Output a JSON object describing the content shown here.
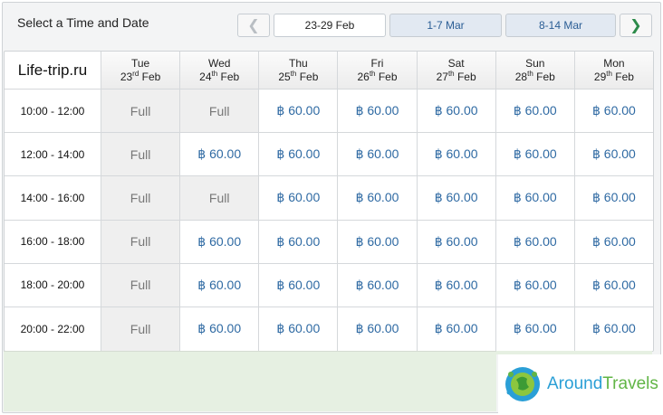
{
  "header": {
    "title": "Select a Time and Date",
    "prev_label": "❮",
    "next_label": "❯",
    "weeks": [
      "23-29 Feb",
      "1-7 Mar",
      "8-14 Mar"
    ]
  },
  "table": {
    "brand": "Life-trip.ru",
    "days": [
      {
        "name": "Tue",
        "num": "23",
        "sup": "rd",
        "month": "Feb"
      },
      {
        "name": "Wed",
        "num": "24",
        "sup": "th",
        "month": "Feb"
      },
      {
        "name": "Thu",
        "num": "25",
        "sup": "th",
        "month": "Feb"
      },
      {
        "name": "Fri",
        "num": "26",
        "sup": "th",
        "month": "Feb"
      },
      {
        "name": "Sat",
        "num": "27",
        "sup": "th",
        "month": "Feb"
      },
      {
        "name": "Sun",
        "num": "28",
        "sup": "th",
        "month": "Feb"
      },
      {
        "name": "Mon",
        "num": "29",
        "sup": "th",
        "month": "Feb"
      }
    ],
    "rows": [
      {
        "time": "10:00 - 12:00",
        "slots": [
          "Full",
          "Full",
          "฿ 60.00",
          "฿ 60.00",
          "฿ 60.00",
          "฿ 60.00",
          "฿ 60.00"
        ]
      },
      {
        "time": "12:00 - 14:00",
        "slots": [
          "Full",
          "฿ 60.00",
          "฿ 60.00",
          "฿ 60.00",
          "฿ 60.00",
          "฿ 60.00",
          "฿ 60.00"
        ]
      },
      {
        "time": "14:00 - 16:00",
        "slots": [
          "Full",
          "Full",
          "฿ 60.00",
          "฿ 60.00",
          "฿ 60.00",
          "฿ 60.00",
          "฿ 60.00"
        ]
      },
      {
        "time": "16:00 - 18:00",
        "slots": [
          "Full",
          "฿ 60.00",
          "฿ 60.00",
          "฿ 60.00",
          "฿ 60.00",
          "฿ 60.00",
          "฿ 60.00"
        ]
      },
      {
        "time": "18:00 - 20:00",
        "slots": [
          "Full",
          "฿ 60.00",
          "฿ 60.00",
          "฿ 60.00",
          "฿ 60.00",
          "฿ 60.00",
          "฿ 60.00"
        ]
      },
      {
        "time": "20:00 - 22:00",
        "slots": [
          "Full",
          "฿ 60.00",
          "฿ 60.00",
          "฿ 60.00",
          "฿ 60.00",
          "฿ 60.00",
          "฿ 60.00"
        ]
      }
    ]
  },
  "logo": {
    "part1": "Around",
    "part2": "Travels",
    "icon": "globe-icon"
  },
  "colors": {
    "price": "#2f6aa3",
    "full_bg": "#efefef",
    "footer_green": "#e6f0e2",
    "logo_blue": "#2a9fd6",
    "logo_green": "#61b546"
  }
}
